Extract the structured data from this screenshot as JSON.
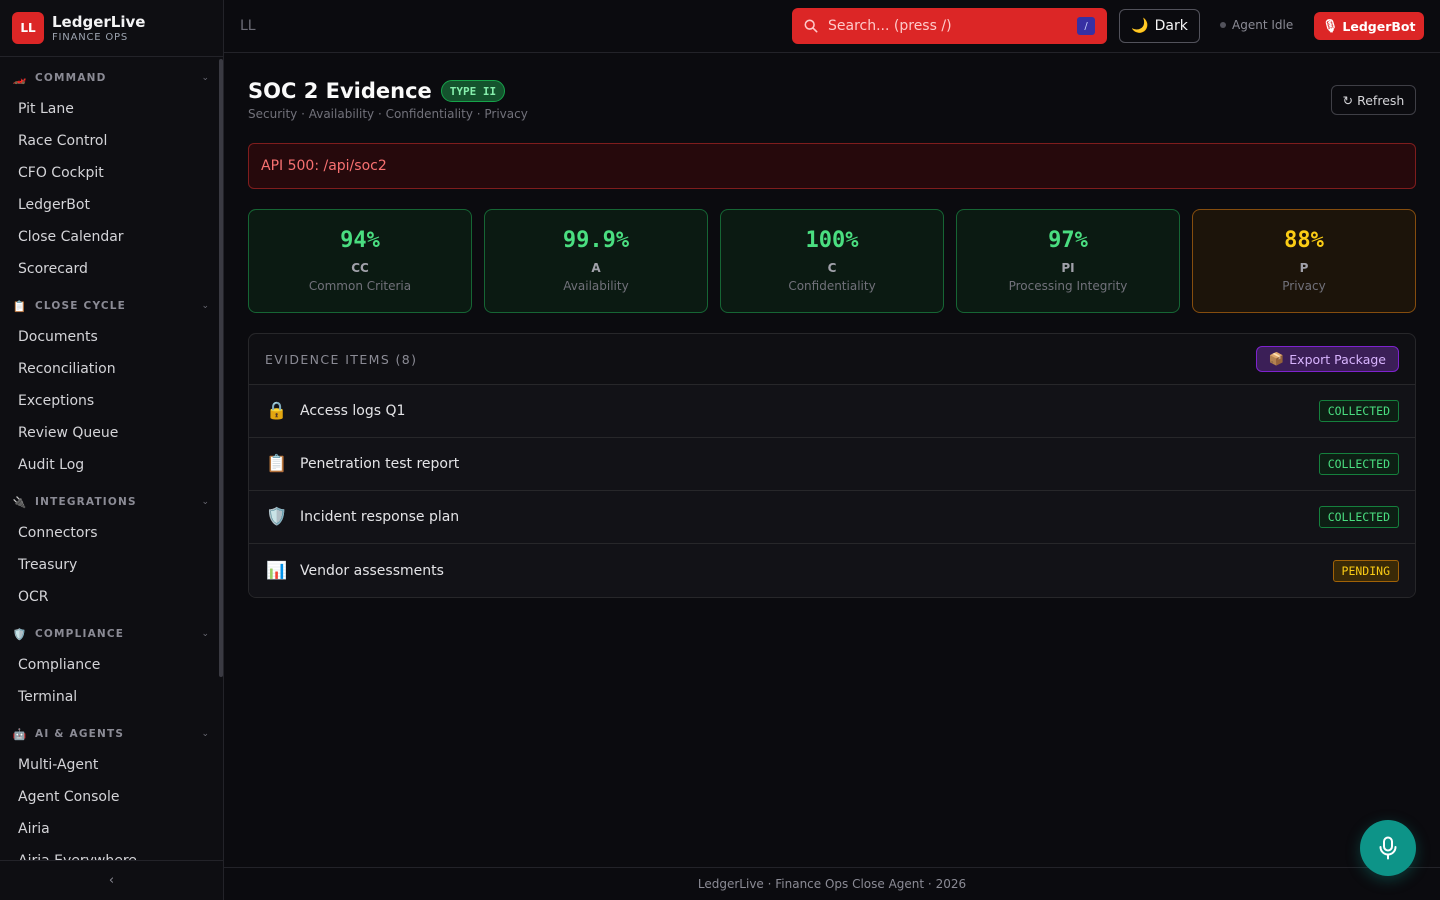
{
  "brand": {
    "logo": "LL",
    "name": "LedgerLive",
    "subtitle": "FINANCE OPS"
  },
  "sidebar": {
    "groups": [
      {
        "icon": "🏎️",
        "icon_name": "race-car-icon",
        "label": "COMMAND",
        "items": [
          "Pit Lane",
          "Race Control",
          "CFO Cockpit",
          "LedgerBot",
          "Close Calendar",
          "Scorecard"
        ]
      },
      {
        "icon": "📋",
        "icon_name": "clipboard-icon",
        "label": "CLOSE CYCLE",
        "items": [
          "Documents",
          "Reconciliation",
          "Exceptions",
          "Review Queue",
          "Audit Log"
        ]
      },
      {
        "icon": "🔌",
        "icon_name": "plug-icon",
        "label": "INTEGRATIONS",
        "items": [
          "Connectors",
          "Treasury",
          "OCR"
        ]
      },
      {
        "icon": "🛡️",
        "icon_name": "shield-icon",
        "label": "COMPLIANCE",
        "items": [
          "Compliance",
          "Terminal"
        ]
      },
      {
        "icon": "🤖",
        "icon_name": "robot-icon",
        "label": "AI & AGENTS",
        "items": [
          "Multi-Agent",
          "Agent Console",
          "Airia",
          "Airia Everywhere"
        ]
      }
    ],
    "collapse_glyph": "‹"
  },
  "topbar": {
    "breadcrumb": "LL",
    "search": {
      "placeholder": "Search... (press /)",
      "shortcut": "/"
    },
    "theme": {
      "icon": "🌙",
      "label": "Dark"
    },
    "agent_status": "Agent Idle",
    "bot_button": {
      "icon": "🎙",
      "label": "LedgerBot"
    }
  },
  "page": {
    "title": "SOC 2 Evidence",
    "badge": "TYPE II",
    "subtitle": "Security · Availability · Confidentiality · Privacy",
    "refresh_label": "↻ Refresh",
    "error": "API 500: /api/soc2"
  },
  "kpis": [
    {
      "value": "94%",
      "code": "CC",
      "label": "Common Criteria",
      "status": "ok"
    },
    {
      "value": "99.9%",
      "code": "A",
      "label": "Availability",
      "status": "ok"
    },
    {
      "value": "100%",
      "code": "C",
      "label": "Confidentiality",
      "status": "ok"
    },
    {
      "value": "97%",
      "code": "PI",
      "label": "Processing Integrity",
      "status": "ok"
    },
    {
      "value": "88%",
      "code": "P",
      "label": "Privacy",
      "status": "warn"
    }
  ],
  "evidence": {
    "title": "EVIDENCE ITEMS (8)",
    "export_icon": "📦",
    "export_label": "Export Package",
    "items": [
      {
        "icon": "🔒",
        "icon_name": "lock-icon",
        "label": "Access logs Q1",
        "status": "COLLECTED"
      },
      {
        "icon": "📋",
        "icon_name": "clipboard-icon",
        "label": "Penetration test report",
        "status": "COLLECTED"
      },
      {
        "icon": "🛡️",
        "icon_name": "shield-icon",
        "label": "Incident response plan",
        "status": "COLLECTED"
      },
      {
        "icon": "📊",
        "icon_name": "bar-chart-icon",
        "label": "Vendor assessments",
        "status": "PENDING"
      }
    ]
  },
  "footer": "LedgerLive · Finance Ops Close Agent · 2026",
  "colors": {
    "accent": "#dc2626",
    "ok": "#4ade80",
    "warn": "#facc15",
    "purple": "#d8b4fe",
    "fab": "#0d9488",
    "background": "#0b0b0f"
  }
}
